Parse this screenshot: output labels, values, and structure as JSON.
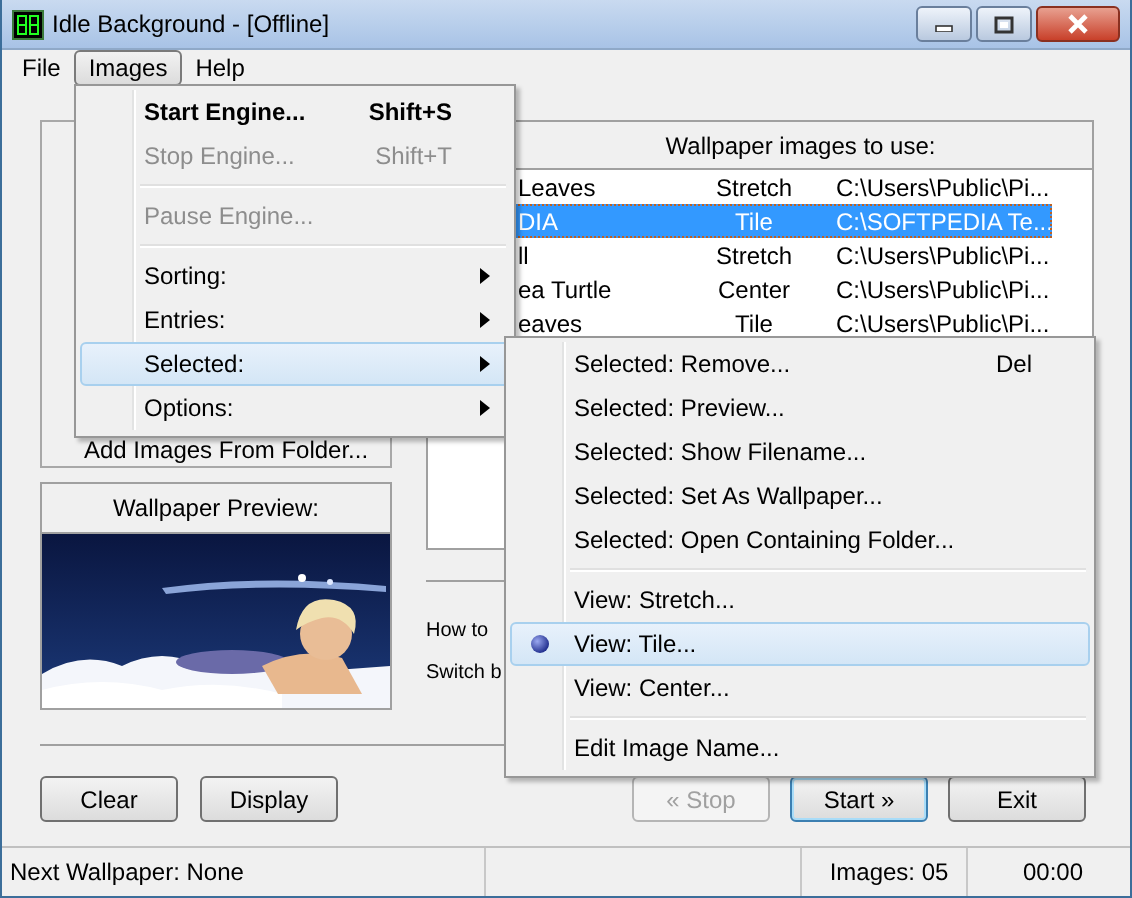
{
  "window": {
    "title": "Idle Background - [Offline]"
  },
  "menu_bar": [
    {
      "label": "File",
      "selected": false
    },
    {
      "label": "Images",
      "selected": true
    },
    {
      "label": "Help",
      "selected": false
    }
  ],
  "images_menu": [
    {
      "kind": "item",
      "label": "Start Engine...",
      "shortcut": "Shift+S",
      "default": true,
      "disabled": false,
      "selected": false
    },
    {
      "kind": "item",
      "label": "Stop Engine...",
      "shortcut": "Shift+T",
      "default": false,
      "disabled": true,
      "selected": false
    },
    {
      "kind": "separator"
    },
    {
      "kind": "item",
      "label": "Pause Engine...",
      "default": false,
      "disabled": true,
      "selected": false
    },
    {
      "kind": "separator"
    },
    {
      "kind": "submenu",
      "label": "Sorting:",
      "disabled": false,
      "selected": false
    },
    {
      "kind": "submenu",
      "label": "Entries:",
      "disabled": false,
      "selected": false
    },
    {
      "kind": "submenu",
      "label": "Selected:",
      "disabled": false,
      "selected": true
    },
    {
      "kind": "submenu",
      "label": "Options:",
      "disabled": false,
      "selected": false
    }
  ],
  "selected_submenu": [
    {
      "kind": "item",
      "label": "Selected:  Remove...",
      "shortcut": "Del",
      "checked": false,
      "selected": false
    },
    {
      "kind": "item",
      "label": "Selected:  Preview...",
      "checked": false,
      "selected": false
    },
    {
      "kind": "item",
      "label": "Selected:  Show Filename...",
      "checked": false,
      "selected": false
    },
    {
      "kind": "item",
      "label": "Selected:  Set As Wallpaper...",
      "checked": false,
      "selected": false
    },
    {
      "kind": "item",
      "label": "Selected:  Open Containing Folder...",
      "checked": false,
      "selected": false
    },
    {
      "kind": "separator"
    },
    {
      "kind": "item",
      "label": "View:  Stretch...",
      "checked": false,
      "selected": false
    },
    {
      "kind": "item",
      "label": "View:  Tile...",
      "checked": true,
      "selected": true
    },
    {
      "kind": "item",
      "label": "View:  Center...",
      "checked": false,
      "selected": false
    },
    {
      "kind": "separator"
    },
    {
      "kind": "item",
      "label": "Edit Image Name...",
      "checked": false,
      "selected": false
    }
  ],
  "left_panel": {
    "add_images_label": "Add Images From Folder..."
  },
  "preview": {
    "title": "Wallpaper Preview:",
    "kind": "picture"
  },
  "wallpaper_list": {
    "header": "Wallpaper images to use:",
    "rows": [
      {
        "name": "Leaves",
        "mode": "Stretch",
        "path": "C:\\Users\\Public\\Pi...",
        "selected": false
      },
      {
        "name": "DIA",
        "mode": "Tile",
        "path": "C:\\SOFTPEDIA Te...",
        "selected": true
      },
      {
        "name": "ll",
        "mode": "Stretch",
        "path": "C:\\Users\\Public\\Pi...",
        "selected": false
      },
      {
        "name": "ea Turtle",
        "mode": "Center",
        "path": "C:\\Users\\Public\\Pi...",
        "selected": false
      },
      {
        "name": "eaves",
        "mode": "Tile",
        "path": "C:\\Users\\Public\\Pi...",
        "selected": false
      }
    ]
  },
  "options": [
    {
      "label": "How to"
    },
    {
      "label": "Switch b"
    }
  ],
  "buttons_left": [
    {
      "label": "Clear",
      "disabled": false,
      "default": false
    },
    {
      "label": "Display",
      "disabled": false,
      "default": false
    }
  ],
  "buttons_right": [
    {
      "label": "« Stop",
      "disabled": true,
      "default": false
    },
    {
      "label": "Start »",
      "disabled": false,
      "default": true
    },
    {
      "label": "Exit",
      "disabled": false,
      "default": false
    }
  ],
  "status_bar": [
    "Next Wallpaper:  None",
    "Images:  05",
    "00:00"
  ]
}
